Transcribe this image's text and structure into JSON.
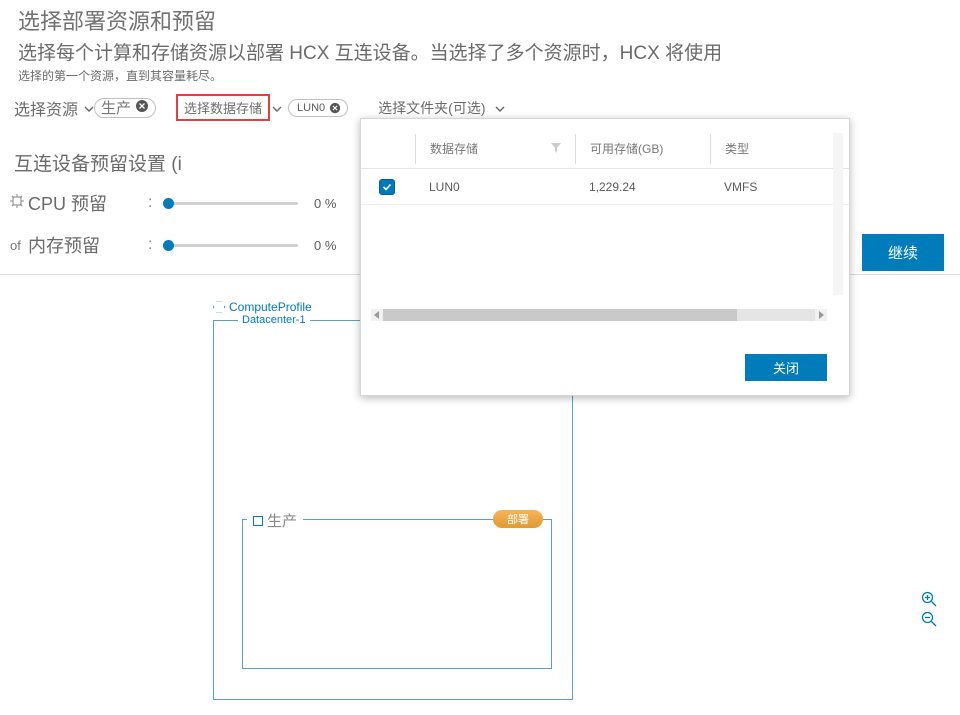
{
  "header": {
    "title": "选择部署资源和预留",
    "desc_line1": "选择每个计算和存储资源以部署 HCX 互连设备。当选择了多个资源时，HCX 将使用",
    "desc_line2": "选择的第一个资源，直到其容量耗尽。"
  },
  "selectors": {
    "resource_label": "选择资源",
    "resource_chip": "生产",
    "datastore_label": "选择数据存储",
    "datastore_chip": "LUN0",
    "folder_label": "选择文件夹(可选)"
  },
  "interconnect": {
    "title": "互连设备预留设置 (i",
    "cpu_label": "CPU 预留",
    "cpu_value": "0 %",
    "mem_label": "内存预留",
    "mem_icon_prefix": "of",
    "mem_value": "0 %"
  },
  "buttons": {
    "continue": "继续",
    "close": "关闭"
  },
  "diagram": {
    "compute_profile": "ComputeProfile",
    "datacenter": "Datacenter-1",
    "cluster": "生产",
    "badge": "部署"
  },
  "dropdown": {
    "columns": {
      "datastore": "数据存储",
      "available": "可用存储(GB)",
      "type": "类型"
    },
    "rows": [
      {
        "checked": true,
        "name": "LUN0",
        "available": "1,229.24",
        "type": "VMFS"
      }
    ]
  }
}
